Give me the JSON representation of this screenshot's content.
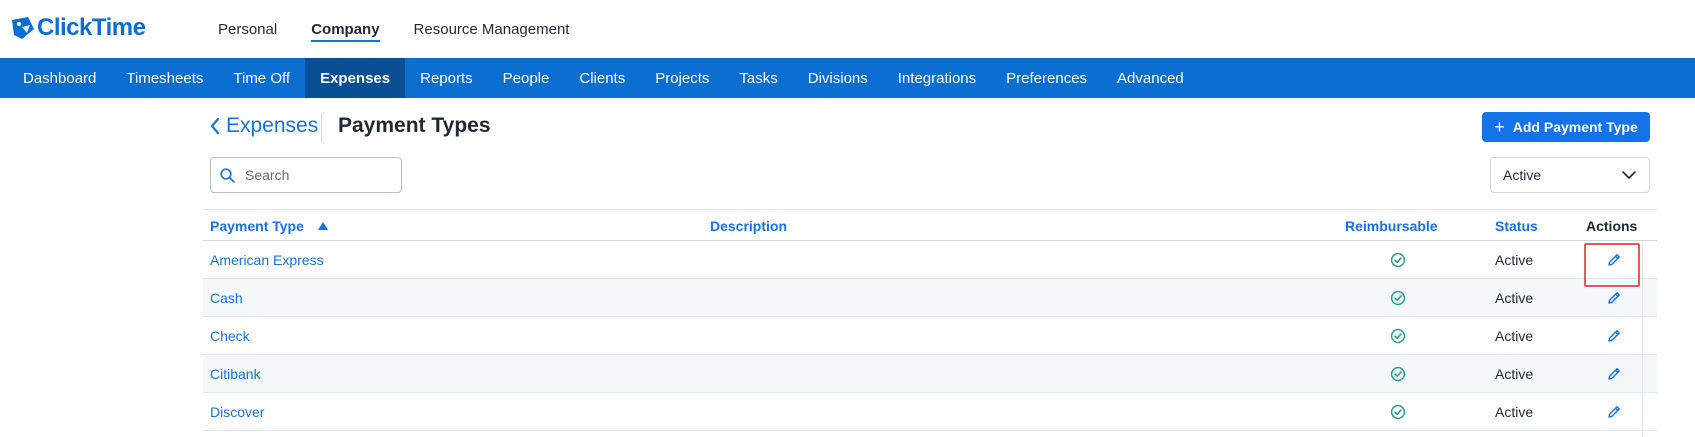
{
  "app": {
    "logo_text": "ClickTime",
    "brand_color": "#0b6fd1",
    "top_tabs": [
      {
        "label": "Personal",
        "active": false
      },
      {
        "label": "Company",
        "active": true
      },
      {
        "label": "Resource Management",
        "active": false
      }
    ]
  },
  "nav": {
    "items": [
      {
        "label": "Dashboard",
        "active": false
      },
      {
        "label": "Timesheets",
        "active": false
      },
      {
        "label": "Time Off",
        "active": false
      },
      {
        "label": "Expenses",
        "active": true
      },
      {
        "label": "Reports",
        "active": false
      },
      {
        "label": "People",
        "active": false
      },
      {
        "label": "Clients",
        "active": false
      },
      {
        "label": "Projects",
        "active": false
      },
      {
        "label": "Tasks",
        "active": false
      },
      {
        "label": "Divisions",
        "active": false
      },
      {
        "label": "Integrations",
        "active": false
      },
      {
        "label": "Preferences",
        "active": false
      },
      {
        "label": "Advanced",
        "active": false
      }
    ]
  },
  "header": {
    "back_label": "Expenses",
    "title": "Payment Types",
    "add_button_label": "Add Payment Type"
  },
  "search": {
    "placeholder": "Search",
    "value": ""
  },
  "filter": {
    "selected": "Active"
  },
  "table": {
    "columns": {
      "name": "Payment Type",
      "description": "Description",
      "reimbursable": "Reimbursable",
      "status": "Status",
      "actions": "Actions"
    },
    "sort": {
      "column": "name",
      "direction": "ascending"
    },
    "rows": [
      {
        "name": "American Express",
        "description": "",
        "reimbursable": true,
        "status": "Active",
        "highlighted": true
      },
      {
        "name": "Cash",
        "description": "",
        "reimbursable": true,
        "status": "Active",
        "highlighted": false
      },
      {
        "name": "Check",
        "description": "",
        "reimbursable": true,
        "status": "Active",
        "highlighted": false
      },
      {
        "name": "Citibank",
        "description": "",
        "reimbursable": true,
        "status": "Active",
        "highlighted": false
      },
      {
        "name": "Discover",
        "description": "",
        "reimbursable": true,
        "status": "Active",
        "highlighted": false
      }
    ],
    "icons": {
      "reimbursable": "check-circle-icon",
      "action": "pencil-icon",
      "check_color": "#1aa37a"
    }
  }
}
